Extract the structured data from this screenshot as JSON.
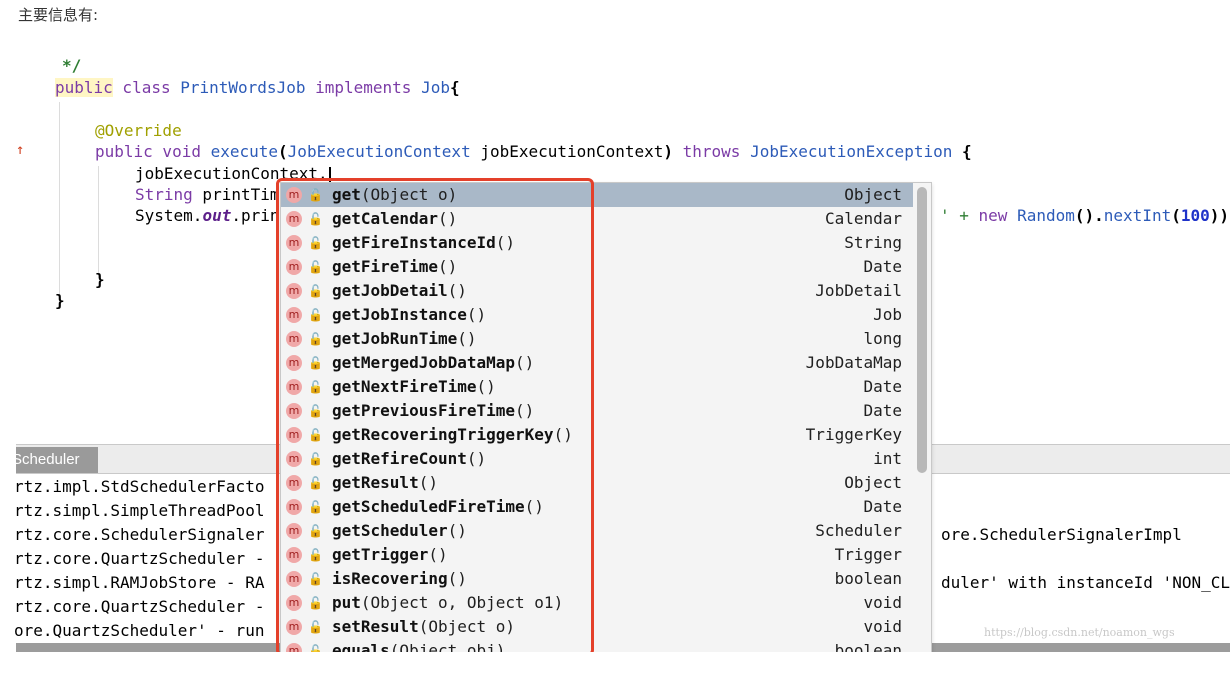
{
  "intro_text": "主要信息有:",
  "code": {
    "comment_end": "*/",
    "kw_public": "public",
    "kw_class": " class ",
    "class_name": "PrintWordsJob",
    "kw_implements": " implements ",
    "iface": "Job",
    "brace_open": "{",
    "annotation": "@Override",
    "method_sig_pre": "public void ",
    "method_name": "execute",
    "paren_open": "(",
    "param_type": "JobExecutionContext",
    "param_name": " jobExecutionContext",
    "paren_close": ")",
    "kw_throws": " throws ",
    "exception": "JobExecutionException",
    "method_brace": " {",
    "line3": "jobExecutionContext.",
    "line4": "String printTim",
    "line5_pre": "System.",
    "line5_out": "out",
    "line5_post": ".prin",
    "line5_tail_pre": "' + ",
    "line5_tail_new": "new",
    "line5_tail_mid": " Random",
    "line5_tail_p1": "().",
    "line5_tail_method": "nextInt",
    "line5_tail_p2": "(",
    "line5_tail_num": "100",
    "line5_tail_p3": "))",
    "close_inner": "}",
    "close_outer": "}"
  },
  "console": {
    "tab_label": "Scheduler",
    "lines": [
      "rtz.impl.StdSchedulerFacto",
      "rtz.simpl.SimpleThreadPool",
      "rtz.core.SchedulerSignaler",
      "rtz.core.QuartzScheduler -",
      "rtz.simpl.RAMJobStore - RA",
      "rtz.core.QuartzScheduler -",
      "ore.QuartzScheduler' - run"
    ],
    "right_lines": [
      "ore.SchedulerSignalerImpl",
      "duler' with instanceId 'NON_CL"
    ],
    "watermark": "https://blog.csdn.net/noamon_wgs"
  },
  "completion": {
    "icon_letter": "m",
    "items": [
      {
        "name": "get",
        "params": "(Object o)",
        "ret": "Object"
      },
      {
        "name": "getCalendar",
        "params": "()",
        "ret": "Calendar"
      },
      {
        "name": "getFireInstanceId",
        "params": "()",
        "ret": "String"
      },
      {
        "name": "getFireTime",
        "params": "()",
        "ret": "Date"
      },
      {
        "name": "getJobDetail",
        "params": "()",
        "ret": "JobDetail"
      },
      {
        "name": "getJobInstance",
        "params": "()",
        "ret": "Job"
      },
      {
        "name": "getJobRunTime",
        "params": "()",
        "ret": "long"
      },
      {
        "name": "getMergedJobDataMap",
        "params": "()",
        "ret": "JobDataMap"
      },
      {
        "name": "getNextFireTime",
        "params": "()",
        "ret": "Date"
      },
      {
        "name": "getPreviousFireTime",
        "params": "()",
        "ret": "Date"
      },
      {
        "name": "getRecoveringTriggerKey",
        "params": "()",
        "ret": "TriggerKey"
      },
      {
        "name": "getRefireCount",
        "params": "()",
        "ret": "int"
      },
      {
        "name": "getResult",
        "params": "()",
        "ret": "Object"
      },
      {
        "name": "getScheduledFireTime",
        "params": "()",
        "ret": "Date"
      },
      {
        "name": "getScheduler",
        "params": "()",
        "ret": "Scheduler"
      },
      {
        "name": "getTrigger",
        "params": "()",
        "ret": "Trigger"
      },
      {
        "name": "isRecovering",
        "params": "()",
        "ret": "boolean"
      },
      {
        "name": "put",
        "params": "(Object o, Object o1)",
        "ret": "void"
      },
      {
        "name": "setResult",
        "params": "(Object o)",
        "ret": "void"
      },
      {
        "name": "equals",
        "params": "(Object obj)",
        "ret": "boolean"
      }
    ]
  }
}
